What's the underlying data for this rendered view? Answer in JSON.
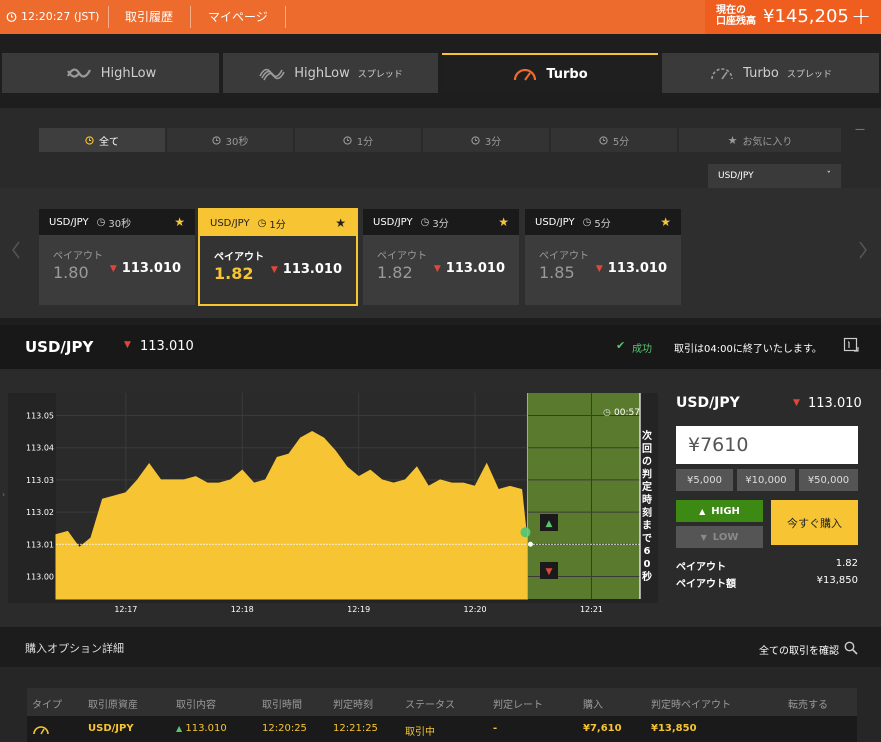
{
  "topbar": {
    "time": "12:20:27 (JST)",
    "history": "取引履歴",
    "mypage": "マイページ",
    "balance_label_1": "現在の",
    "balance_label_2": "口座残高",
    "balance": "¥145,205",
    "plus": "+"
  },
  "product_tabs": [
    {
      "label": "HighLow",
      "sub": ""
    },
    {
      "label": "HighLow",
      "sub": "スプレッド"
    },
    {
      "label": "Turbo",
      "sub": ""
    },
    {
      "label": "Turbo",
      "sub": "スプレッド"
    }
  ],
  "time_filters": [
    "全て",
    "30秒",
    "1分",
    "3分",
    "5分",
    "お気に入り"
  ],
  "minimize": "—",
  "pair_select": {
    "value": "USD/JPY",
    "arrow": "ˇ"
  },
  "cards": [
    {
      "pair": "USD/JPY",
      "duration": "30秒",
      "payout_label": "ペイアウト",
      "payout": "1.80",
      "rate": "113.010"
    },
    {
      "pair": "USD/JPY",
      "duration": "1分",
      "payout_label": "ペイアウト",
      "payout": "1.82",
      "rate": "113.010"
    },
    {
      "pair": "USD/JPY",
      "duration": "3分",
      "payout_label": "ペイアウト",
      "payout": "1.82",
      "rate": "113.010"
    },
    {
      "pair": "USD/JPY",
      "duration": "5分",
      "payout_label": "ペイアウト",
      "payout": "1.85",
      "rate": "113.010"
    }
  ],
  "pair_bar": {
    "pair": "USD/JPY",
    "rate": "113.010",
    "status": "成功",
    "message": "取引は04:00に終了いたします。"
  },
  "chart_data": {
    "type": "area",
    "y_ticks": [
      "113.05",
      "113.04",
      "113.03",
      "113.02",
      "113.01",
      "113.00"
    ],
    "ylim": [
      112.993,
      113.057
    ],
    "x_ticks": [
      "12:17",
      "12:18",
      "12:19",
      "12:20",
      "12:21"
    ],
    "x": [
      "12:16:24",
      "12:16:30",
      "12:16:36",
      "12:16:42",
      "12:16:48",
      "12:16:54",
      "12:17:00",
      "12:17:06",
      "12:17:12",
      "12:17:18",
      "12:17:24",
      "12:17:30",
      "12:17:36",
      "12:17:42",
      "12:17:48",
      "12:17:54",
      "12:18:00",
      "12:18:06",
      "12:18:12",
      "12:18:18",
      "12:18:24",
      "12:18:30",
      "12:18:36",
      "12:18:42",
      "12:18:48",
      "12:18:54",
      "12:19:00",
      "12:19:06",
      "12:19:12",
      "12:19:18",
      "12:19:24",
      "12:19:30",
      "12:19:36",
      "12:19:42",
      "12:19:48",
      "12:19:54",
      "12:20:00",
      "12:20:06",
      "12:20:12",
      "12:20:18",
      "12:20:24",
      "12:20:27"
    ],
    "values": [
      113.013,
      113.014,
      113.009,
      113.012,
      113.024,
      113.025,
      113.026,
      113.03,
      113.035,
      113.03,
      113.03,
      113.03,
      113.031,
      113.029,
      113.029,
      113.03,
      113.033,
      113.029,
      113.03,
      113.037,
      113.038,
      113.043,
      113.045,
      113.043,
      113.039,
      113.034,
      113.031,
      113.033,
      113.03,
      113.029,
      113.03,
      113.034,
      113.028,
      113.03,
      113.029,
      113.029,
      113.028,
      113.035,
      113.027,
      113.028,
      113.027,
      113.01
    ],
    "current_rate": "113.010",
    "countdown": "00:57",
    "expiry_text": "次回の判定時刻まで60秒"
  },
  "side": {
    "pair": "USD/JPY",
    "rate": "113.010",
    "amount": "¥7610",
    "quick": [
      "¥5,000",
      "¥10,000",
      "¥50,000"
    ],
    "high": "HIGH",
    "low": "LOW",
    "buy": "今すぐ購入",
    "payout_label": "ペイアウト",
    "payout": "1.82",
    "payout_amount_label": "ペイアウト額",
    "payout_amount": "¥13,850"
  },
  "details": {
    "title": "購入オプション詳細",
    "link": "全ての取引を確認",
    "headers": [
      "タイプ",
      "取引原資産",
      "取引内容",
      "取引時間",
      "判定時刻",
      "ステータス",
      "判定レート",
      "購入",
      "判定時ペイアウト",
      "転売する"
    ],
    "row": {
      "asset": "USD/JPY",
      "content": "113.010",
      "time": "12:20:25",
      "expiry": "12:21:25",
      "status": "取引中",
      "rate": "-",
      "purchase": "¥7,610",
      "payout": "¥13,850"
    }
  },
  "colors": {
    "orange": "#ec6b2d",
    "yellow": "#f7c533",
    "green": "#3c8a14"
  }
}
